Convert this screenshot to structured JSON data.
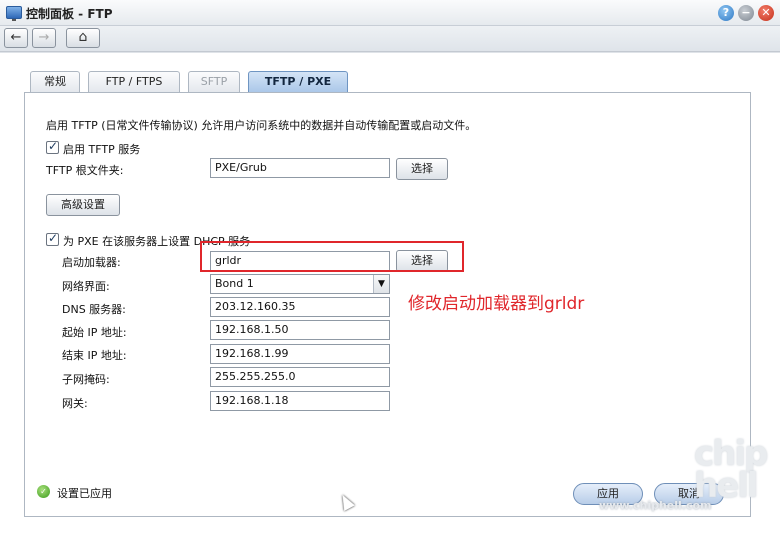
{
  "window": {
    "title": "控制面板 - FTP",
    "help_icon": "?",
    "min_icon": "−",
    "close_icon": "✕"
  },
  "nav": {
    "back_icon": "←",
    "forward_icon": "→",
    "home_icon": "⌂"
  },
  "tabs": [
    {
      "label": "常规"
    },
    {
      "label": "FTP / FTPS"
    },
    {
      "label": "SFTP"
    },
    {
      "label": "TFTP / PXE"
    }
  ],
  "form": {
    "description": "启用 TFTP (日常文件传输协议) 允许用户访问系统中的数据并自动传输配置或启动文件。",
    "enable_tftp_label": "启用 TFTP 服务",
    "root_folder_label": "TFTP 根文件夹:",
    "root_folder_value": "PXE/Grub",
    "select_label": "选择",
    "advanced_label": "高级设置",
    "pxe_dhcp_label": "为 PXE 在该服务器上设置 DHCP 服务",
    "boot_loader_label": "启动加载器:",
    "boot_loader_value": "grldr",
    "boot_select_label": "选择",
    "interface_label": "网络界面:",
    "interface_value": "Bond 1",
    "dns_label": "DNS 服务器:",
    "dns_value": "203.12.160.35",
    "start_ip_label": "起始 IP 地址:",
    "start_ip_value": "192.168.1.50",
    "end_ip_label": "结束 IP 地址:",
    "end_ip_value": "192.168.1.99",
    "mask_label": "子网掩码:",
    "mask_value": "255.255.255.0",
    "gateway_label": "网关:",
    "gateway_value": "192.168.1.18"
  },
  "annotation": {
    "text": "修改启动加载器到grldr",
    "color": "#e0262b"
  },
  "footer": {
    "status_text": "设置已应用",
    "apply_label": "应用",
    "cancel_label": "取消"
  },
  "watermark": {
    "logo_text": "chip hell",
    "url": "www.chiphell.com"
  }
}
